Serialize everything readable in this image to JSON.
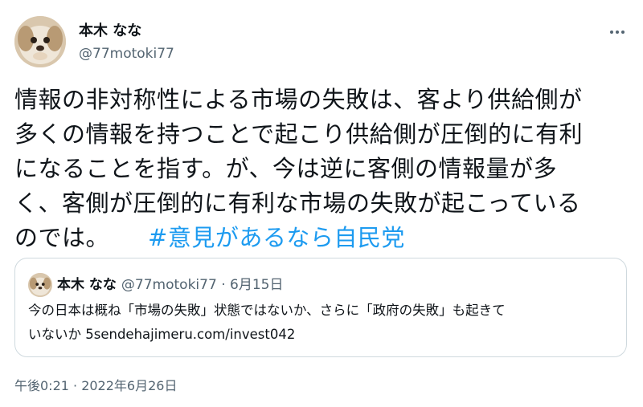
{
  "author": {
    "display_name": "本木 なな",
    "handle": "@77motoki77",
    "avatar_icon": "dog-avatar-icon"
  },
  "more_icon": "more-horizontal-icon",
  "tweet": {
    "lines": [
      "情報の非対称性による市場の失敗は、客より供給側が",
      "多くの情報を持つことで起こり供給側が圧倒的に有利",
      "になることを指す。が、今は逆に客側の情報量が多",
      "く、客側が圧倒的に有利な市場の失敗が起こっている",
      "のでは。"
    ],
    "hashtag": "#意見があるなら自民党"
  },
  "quote": {
    "display_name": "本木 なな",
    "handle": "@77motoki77",
    "separator": "·",
    "date": "6月15日",
    "lines": [
      "今の日本は概ね「市場の失敗」状態ではないか、さらに「政府の失敗」も起きて",
      "いないか 5sendehajimeru.com/invest042"
    ]
  },
  "timestamp": "午後0:21 · 2022年6月26日",
  "colors": {
    "text": "#0f1419",
    "secondary": "#536471",
    "link": "#1d9bf0",
    "border": "#cfd9de"
  }
}
